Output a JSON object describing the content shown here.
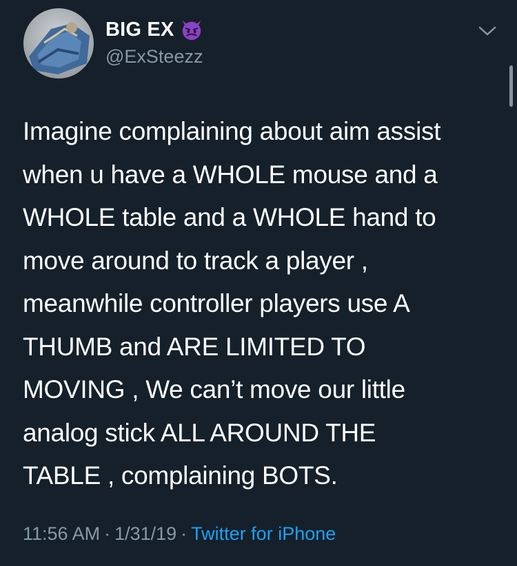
{
  "tweet": {
    "author": {
      "display_name": "BIG EX",
      "name_emoji": "smiling-imp-emoji",
      "handle": "@ExSteezz",
      "avatar": "avatar-icon"
    },
    "menu_icon": "chevron-down-icon",
    "text": "Imagine complaining about aim assist\nwhen u have a WHOLE mouse and a\nWHOLE table and a WHOLE hand to\nmove around to track a player ,\nmeanwhile controller players use A\nTHUMB and ARE LIMITED TO\nMOVING , We can’t move our little\nanalog stick ALL AROUND THE\nTABLE , complaining BOTS.",
    "time": "11:56 AM",
    "separator": "·",
    "date": "1/31/19",
    "source": "Twitter for iPhone"
  },
  "colors": {
    "background": "#15202b",
    "secondary_text": "#8899a6",
    "link": "#1da1f2",
    "emoji": "#8a43c4"
  }
}
